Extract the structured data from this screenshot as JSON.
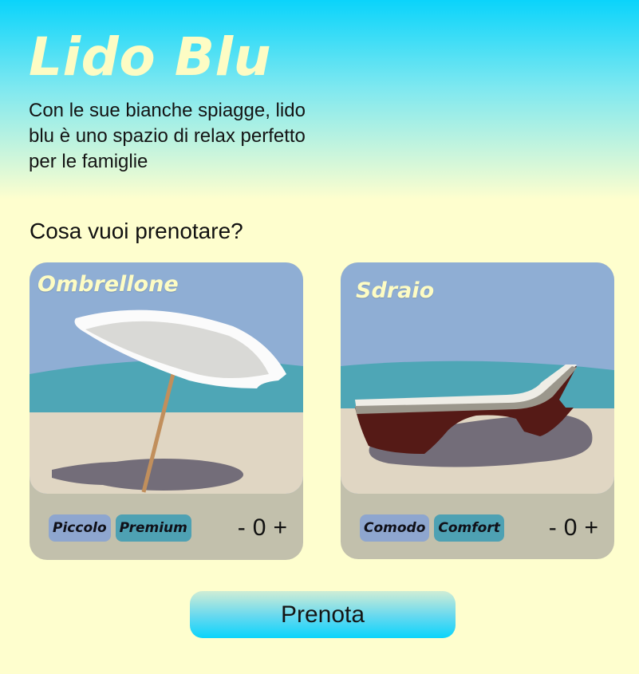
{
  "header": {
    "title": "Lido Blu",
    "subtitle": "Con le sue bianche spiagge, lido blu è uno spazio di relax perfetto per le famiglie"
  },
  "question": "Cosa vuoi prenotare?",
  "cards": [
    {
      "title": "Ombrellone",
      "illustration": "beach-umbrella",
      "tags": [
        "Piccolo",
        "Premium"
      ],
      "stepper": {
        "minus": "-",
        "count": "0",
        "plus": "+"
      }
    },
    {
      "title": "Sdraio",
      "illustration": "sun-lounger",
      "tags": [
        "Comodo",
        "Comfort"
      ],
      "stepper": {
        "minus": "-",
        "count": "0",
        "plus": "+"
      }
    }
  ],
  "action": {
    "label": "Prenota"
  },
  "colors": {
    "sky": "#8faed4",
    "sea": "#4ea6b6",
    "sand": "#e0d6c3",
    "title_yellow": "#fdfcc4",
    "tag_blue": "#8ea6cf",
    "tag_teal": "#4ea1b3",
    "button_cyan": "#0ad4fb"
  }
}
